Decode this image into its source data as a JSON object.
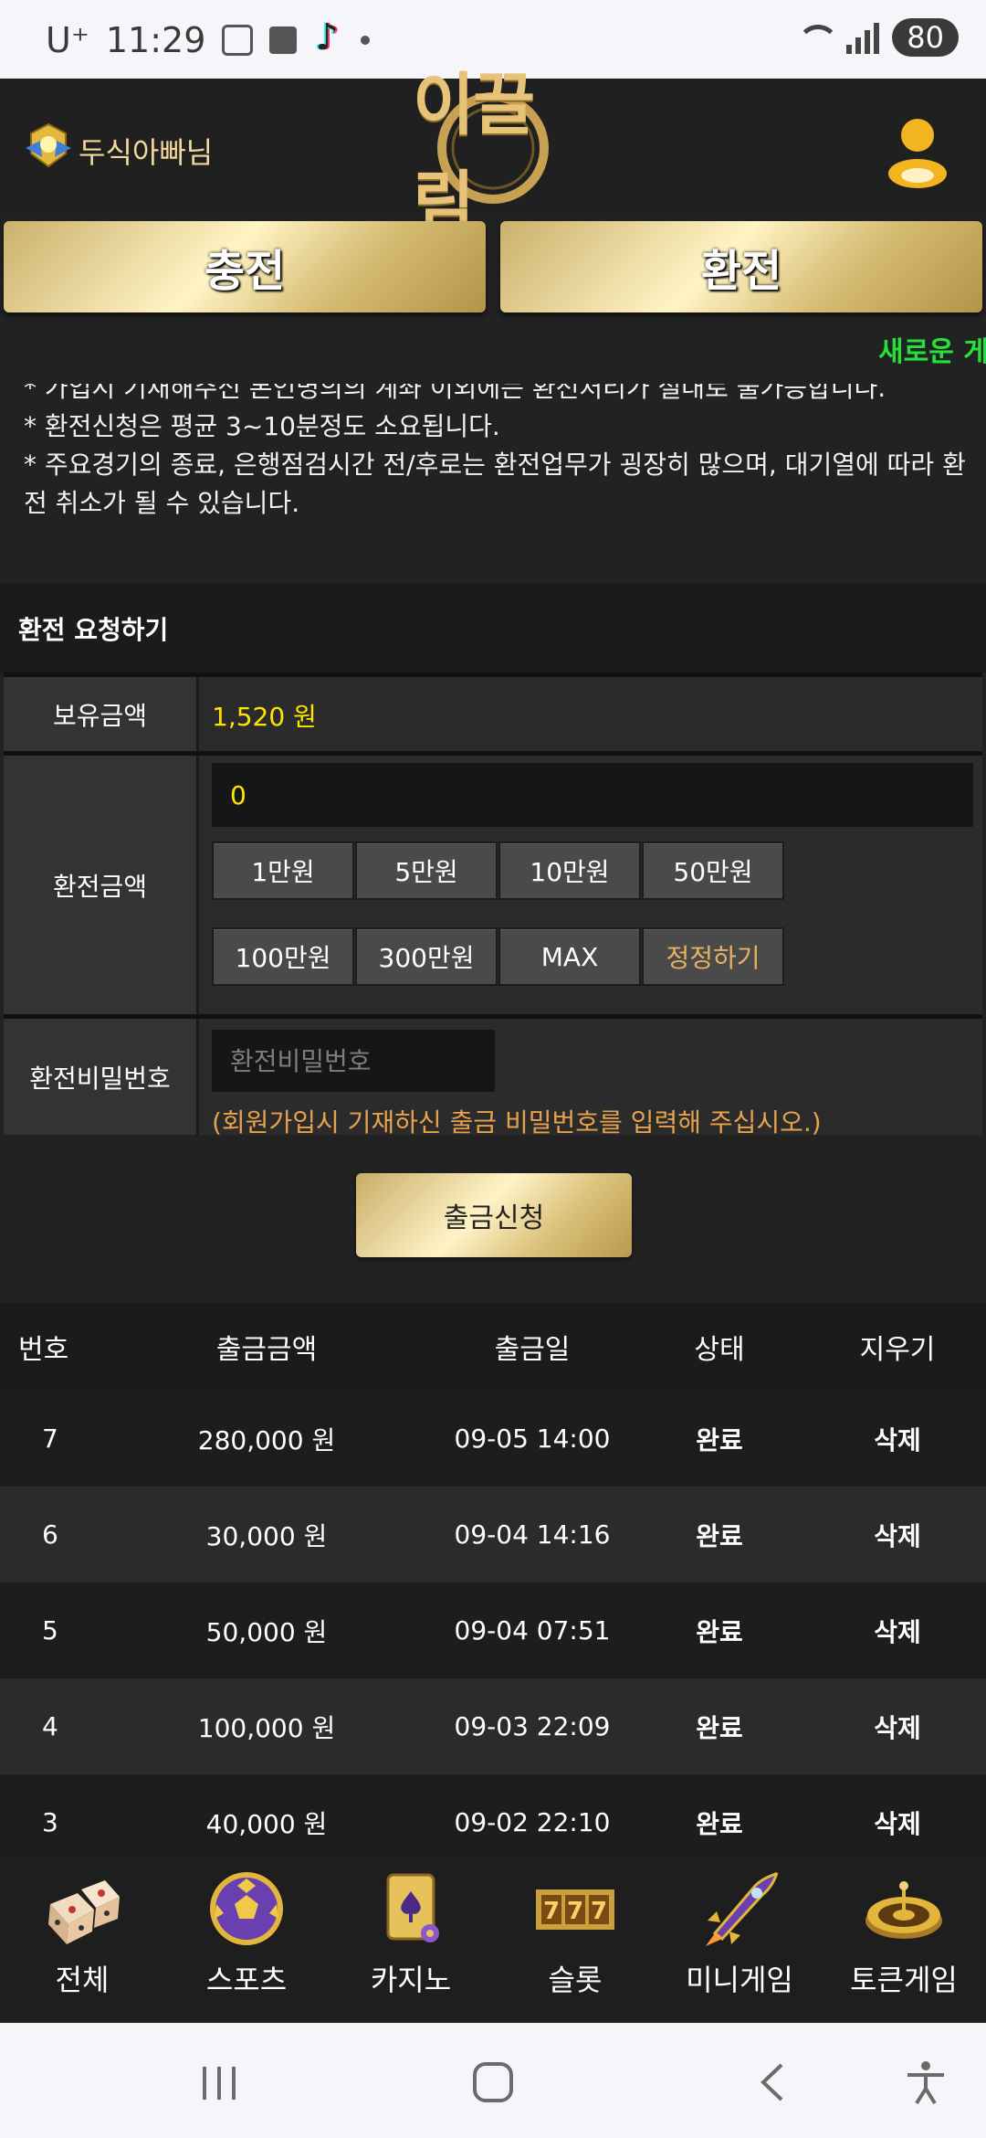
{
  "status_bar": {
    "carrier": "U⁺",
    "time": "11:29",
    "battery": "80"
  },
  "header": {
    "username": "두식아빠님",
    "logo_text": "이끌림"
  },
  "tabs": {
    "charge": "충전",
    "exchange": "환전"
  },
  "ticker": "새로운 게",
  "notice": {
    "partial_line": "* 가입시 기재해주신 본인명의의 계좌 이외에는 환전처리가 절대로 불가능합니다.",
    "line2": "* 환전신청은 평균 3~10분정도 소요됩니다.",
    "line3": "* 주요경기의 종료, 은행점검시간 전/후로는 환전업무가 굉장히 많으며, 대기열에 따라 환전 취소가 될 수 있습니다."
  },
  "section_title": "환전 요청하기",
  "form": {
    "balance_label": "보유금액",
    "balance_value": "1,520 원",
    "amount_label": "환전금액",
    "amount_value": "0",
    "quick_buttons": [
      "1만원",
      "5만원",
      "10만원",
      "50만원",
      "100만원",
      "300만원",
      "MAX",
      "정정하기"
    ],
    "password_label": "환전비밀번호",
    "password_placeholder": "환전비밀번호",
    "password_hint": "(회원가입시 기재하신 출금 비밀번호를 입력해 주십시오.)",
    "submit_label": "출금신청"
  },
  "table": {
    "headers": [
      "번호",
      "출금금액",
      "출금일",
      "상태",
      "지우기"
    ],
    "rows": [
      {
        "no": "7",
        "amount": "280,000 원",
        "date": "09-05 14:00",
        "status": "완료",
        "action": "삭제"
      },
      {
        "no": "6",
        "amount": "30,000 원",
        "date": "09-04 14:16",
        "status": "완료",
        "action": "삭제"
      },
      {
        "no": "5",
        "amount": "50,000 원",
        "date": "09-04 07:51",
        "status": "완료",
        "action": "삭제"
      },
      {
        "no": "4",
        "amount": "100,000 원",
        "date": "09-03 22:09",
        "status": "완료",
        "action": "삭제"
      },
      {
        "no": "3",
        "amount": "40,000 원",
        "date": "09-02 22:10",
        "status": "완료",
        "action": "삭제"
      }
    ]
  },
  "game_nav": {
    "items": [
      {
        "label": "전체",
        "icon": "dice-icon"
      },
      {
        "label": "스포츠",
        "icon": "soccer-ball-icon"
      },
      {
        "label": "카지노",
        "icon": "playing-card-icon"
      },
      {
        "label": "슬롯",
        "icon": "slot-777-icon"
      },
      {
        "label": "미니게임",
        "icon": "rocket-icon"
      },
      {
        "label": "토큰게임",
        "icon": "roulette-icon"
      }
    ]
  },
  "colors": {
    "gold": "#e7c37a",
    "yellow_value": "#ffe400",
    "hint_orange": "#e8a24c",
    "ticker_green": "#26e03a",
    "bg": "#222222"
  }
}
